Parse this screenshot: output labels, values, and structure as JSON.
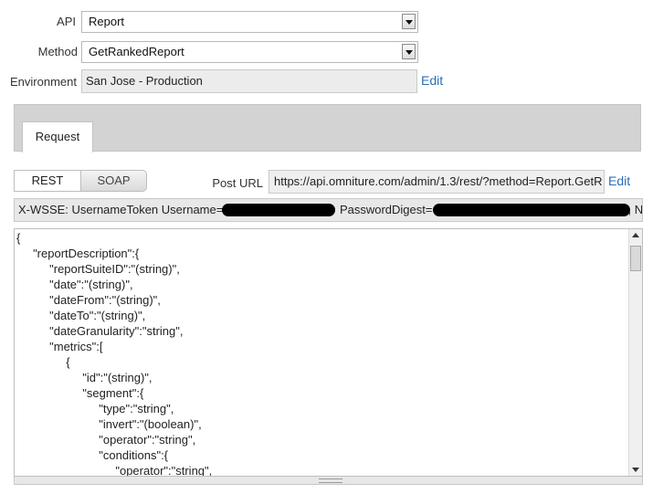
{
  "form": {
    "api_label": "API",
    "api_value": "Report",
    "method_label": "Method",
    "method_value": "GetRankedReport",
    "env_label": "Environment",
    "env_value": "San Jose - Production",
    "env_edit": "Edit"
  },
  "tabs": [
    {
      "label": "Request",
      "active": true
    }
  ],
  "toggle": {
    "rest": "REST",
    "soap": "SOAP",
    "selected": "REST"
  },
  "post_url": {
    "label": "Post URL",
    "value": "https://api.omniture.com/admin/1.3/rest/?method=Report.GetR",
    "edit": "Edit"
  },
  "header": {
    "prefix": "X-WSSE: UsernameToken Username=",
    "middle": " PasswordDigest=",
    "suffix": ", N"
  },
  "code_lines": [
    "{",
    "\t\"reportDescription\":{",
    "\t\t\"reportSuiteID\":\"(string)\",",
    "\t\t\"date\":\"(string)\",",
    "\t\t\"dateFrom\":\"(string)\",",
    "\t\t\"dateTo\":\"(string)\",",
    "\t\t\"dateGranularity\":\"string\",",
    "\t\t\"metrics\":[",
    "\t\t\t{",
    "\t\t\t\t\"id\":\"(string)\",",
    "\t\t\t\t\"segment\":{",
    "\t\t\t\t\t\"type\":\"string\",",
    "\t\t\t\t\t\"invert\":\"(boolean)\",",
    "\t\t\t\t\t\"operator\":\"string\",",
    "\t\t\t\t\t\"conditions\":{",
    "\t\t\t\t\t\t\"operator\":\"string\","
  ],
  "colors": {
    "link": "#2a6fb5",
    "tabbar": "#d3d3d3",
    "readonly": "#ececec"
  }
}
